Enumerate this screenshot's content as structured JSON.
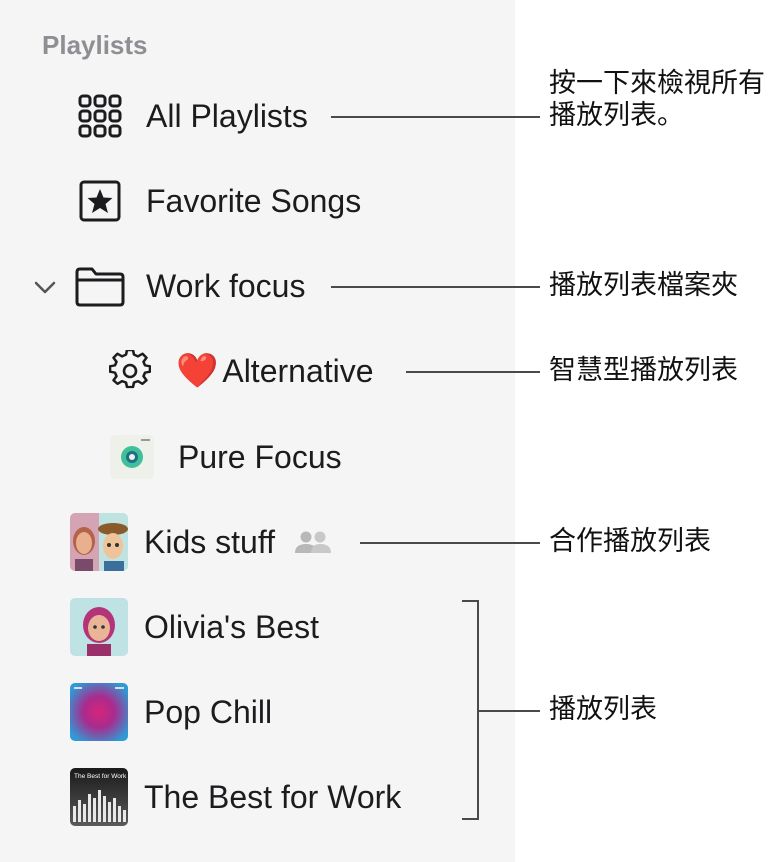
{
  "sidebar": {
    "section_title": "Playlists",
    "items": {
      "all_playlists": {
        "label": "All Playlists",
        "icon": "grid-icon"
      },
      "favorite_songs": {
        "label": "Favorite Songs",
        "icon": "star-box-icon"
      },
      "work_focus": {
        "label": "Work focus",
        "icon": "folder-icon",
        "expanded": true
      },
      "alternative": {
        "label": "Alternative",
        "emoji": "❤️",
        "icon": "gear-icon"
      },
      "pure_focus": {
        "label": "Pure Focus",
        "icon": "pure-focus-artwork"
      },
      "kids_stuff": {
        "label": "Kids stuff",
        "icon": "kids-stuff-artwork",
        "badge_icon": "people-icon"
      },
      "olivias_best": {
        "label": "Olivia's Best",
        "icon": "olivia-artwork"
      },
      "pop_chill": {
        "label": "Pop Chill",
        "icon": "pop-chill-artwork"
      },
      "best_for_work": {
        "label": "The Best for Work",
        "icon": "best-for-work-artwork",
        "artwork_text": "The Best for Work"
      }
    }
  },
  "callouts": {
    "all_playlists": "按一下來檢視所有\n播放列表。",
    "folder": "播放列表檔案夾",
    "smart": "智慧型播放列表",
    "collaborative": "合作播放列表",
    "playlists": "播放列表"
  },
  "colors": {
    "sidebar_bg": "#f5f5f5",
    "section_title": "#8e8e93",
    "text": "#1c1c1e",
    "heart": "#e0242c"
  }
}
